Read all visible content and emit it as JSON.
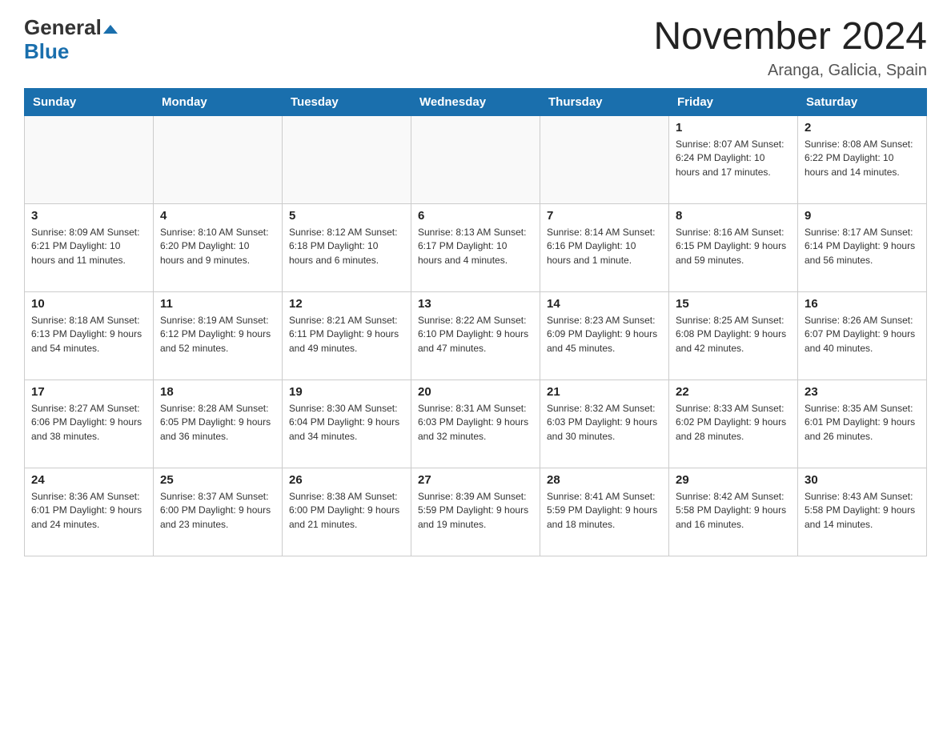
{
  "header": {
    "logo_line1": "General",
    "logo_line2": "Blue",
    "month_year": "November 2024",
    "location": "Aranga, Galicia, Spain"
  },
  "days_of_week": [
    "Sunday",
    "Monday",
    "Tuesday",
    "Wednesday",
    "Thursday",
    "Friday",
    "Saturday"
  ],
  "weeks": [
    [
      {
        "day": "",
        "info": ""
      },
      {
        "day": "",
        "info": ""
      },
      {
        "day": "",
        "info": ""
      },
      {
        "day": "",
        "info": ""
      },
      {
        "day": "",
        "info": ""
      },
      {
        "day": "1",
        "info": "Sunrise: 8:07 AM\nSunset: 6:24 PM\nDaylight: 10 hours and 17 minutes."
      },
      {
        "day": "2",
        "info": "Sunrise: 8:08 AM\nSunset: 6:22 PM\nDaylight: 10 hours and 14 minutes."
      }
    ],
    [
      {
        "day": "3",
        "info": "Sunrise: 8:09 AM\nSunset: 6:21 PM\nDaylight: 10 hours and 11 minutes."
      },
      {
        "day": "4",
        "info": "Sunrise: 8:10 AM\nSunset: 6:20 PM\nDaylight: 10 hours and 9 minutes."
      },
      {
        "day": "5",
        "info": "Sunrise: 8:12 AM\nSunset: 6:18 PM\nDaylight: 10 hours and 6 minutes."
      },
      {
        "day": "6",
        "info": "Sunrise: 8:13 AM\nSunset: 6:17 PM\nDaylight: 10 hours and 4 minutes."
      },
      {
        "day": "7",
        "info": "Sunrise: 8:14 AM\nSunset: 6:16 PM\nDaylight: 10 hours and 1 minute."
      },
      {
        "day": "8",
        "info": "Sunrise: 8:16 AM\nSunset: 6:15 PM\nDaylight: 9 hours and 59 minutes."
      },
      {
        "day": "9",
        "info": "Sunrise: 8:17 AM\nSunset: 6:14 PM\nDaylight: 9 hours and 56 minutes."
      }
    ],
    [
      {
        "day": "10",
        "info": "Sunrise: 8:18 AM\nSunset: 6:13 PM\nDaylight: 9 hours and 54 minutes."
      },
      {
        "day": "11",
        "info": "Sunrise: 8:19 AM\nSunset: 6:12 PM\nDaylight: 9 hours and 52 minutes."
      },
      {
        "day": "12",
        "info": "Sunrise: 8:21 AM\nSunset: 6:11 PM\nDaylight: 9 hours and 49 minutes."
      },
      {
        "day": "13",
        "info": "Sunrise: 8:22 AM\nSunset: 6:10 PM\nDaylight: 9 hours and 47 minutes."
      },
      {
        "day": "14",
        "info": "Sunrise: 8:23 AM\nSunset: 6:09 PM\nDaylight: 9 hours and 45 minutes."
      },
      {
        "day": "15",
        "info": "Sunrise: 8:25 AM\nSunset: 6:08 PM\nDaylight: 9 hours and 42 minutes."
      },
      {
        "day": "16",
        "info": "Sunrise: 8:26 AM\nSunset: 6:07 PM\nDaylight: 9 hours and 40 minutes."
      }
    ],
    [
      {
        "day": "17",
        "info": "Sunrise: 8:27 AM\nSunset: 6:06 PM\nDaylight: 9 hours and 38 minutes."
      },
      {
        "day": "18",
        "info": "Sunrise: 8:28 AM\nSunset: 6:05 PM\nDaylight: 9 hours and 36 minutes."
      },
      {
        "day": "19",
        "info": "Sunrise: 8:30 AM\nSunset: 6:04 PM\nDaylight: 9 hours and 34 minutes."
      },
      {
        "day": "20",
        "info": "Sunrise: 8:31 AM\nSunset: 6:03 PM\nDaylight: 9 hours and 32 minutes."
      },
      {
        "day": "21",
        "info": "Sunrise: 8:32 AM\nSunset: 6:03 PM\nDaylight: 9 hours and 30 minutes."
      },
      {
        "day": "22",
        "info": "Sunrise: 8:33 AM\nSunset: 6:02 PM\nDaylight: 9 hours and 28 minutes."
      },
      {
        "day": "23",
        "info": "Sunrise: 8:35 AM\nSunset: 6:01 PM\nDaylight: 9 hours and 26 minutes."
      }
    ],
    [
      {
        "day": "24",
        "info": "Sunrise: 8:36 AM\nSunset: 6:01 PM\nDaylight: 9 hours and 24 minutes."
      },
      {
        "day": "25",
        "info": "Sunrise: 8:37 AM\nSunset: 6:00 PM\nDaylight: 9 hours and 23 minutes."
      },
      {
        "day": "26",
        "info": "Sunrise: 8:38 AM\nSunset: 6:00 PM\nDaylight: 9 hours and 21 minutes."
      },
      {
        "day": "27",
        "info": "Sunrise: 8:39 AM\nSunset: 5:59 PM\nDaylight: 9 hours and 19 minutes."
      },
      {
        "day": "28",
        "info": "Sunrise: 8:41 AM\nSunset: 5:59 PM\nDaylight: 9 hours and 18 minutes."
      },
      {
        "day": "29",
        "info": "Sunrise: 8:42 AM\nSunset: 5:58 PM\nDaylight: 9 hours and 16 minutes."
      },
      {
        "day": "30",
        "info": "Sunrise: 8:43 AM\nSunset: 5:58 PM\nDaylight: 9 hours and 14 minutes."
      }
    ]
  ]
}
